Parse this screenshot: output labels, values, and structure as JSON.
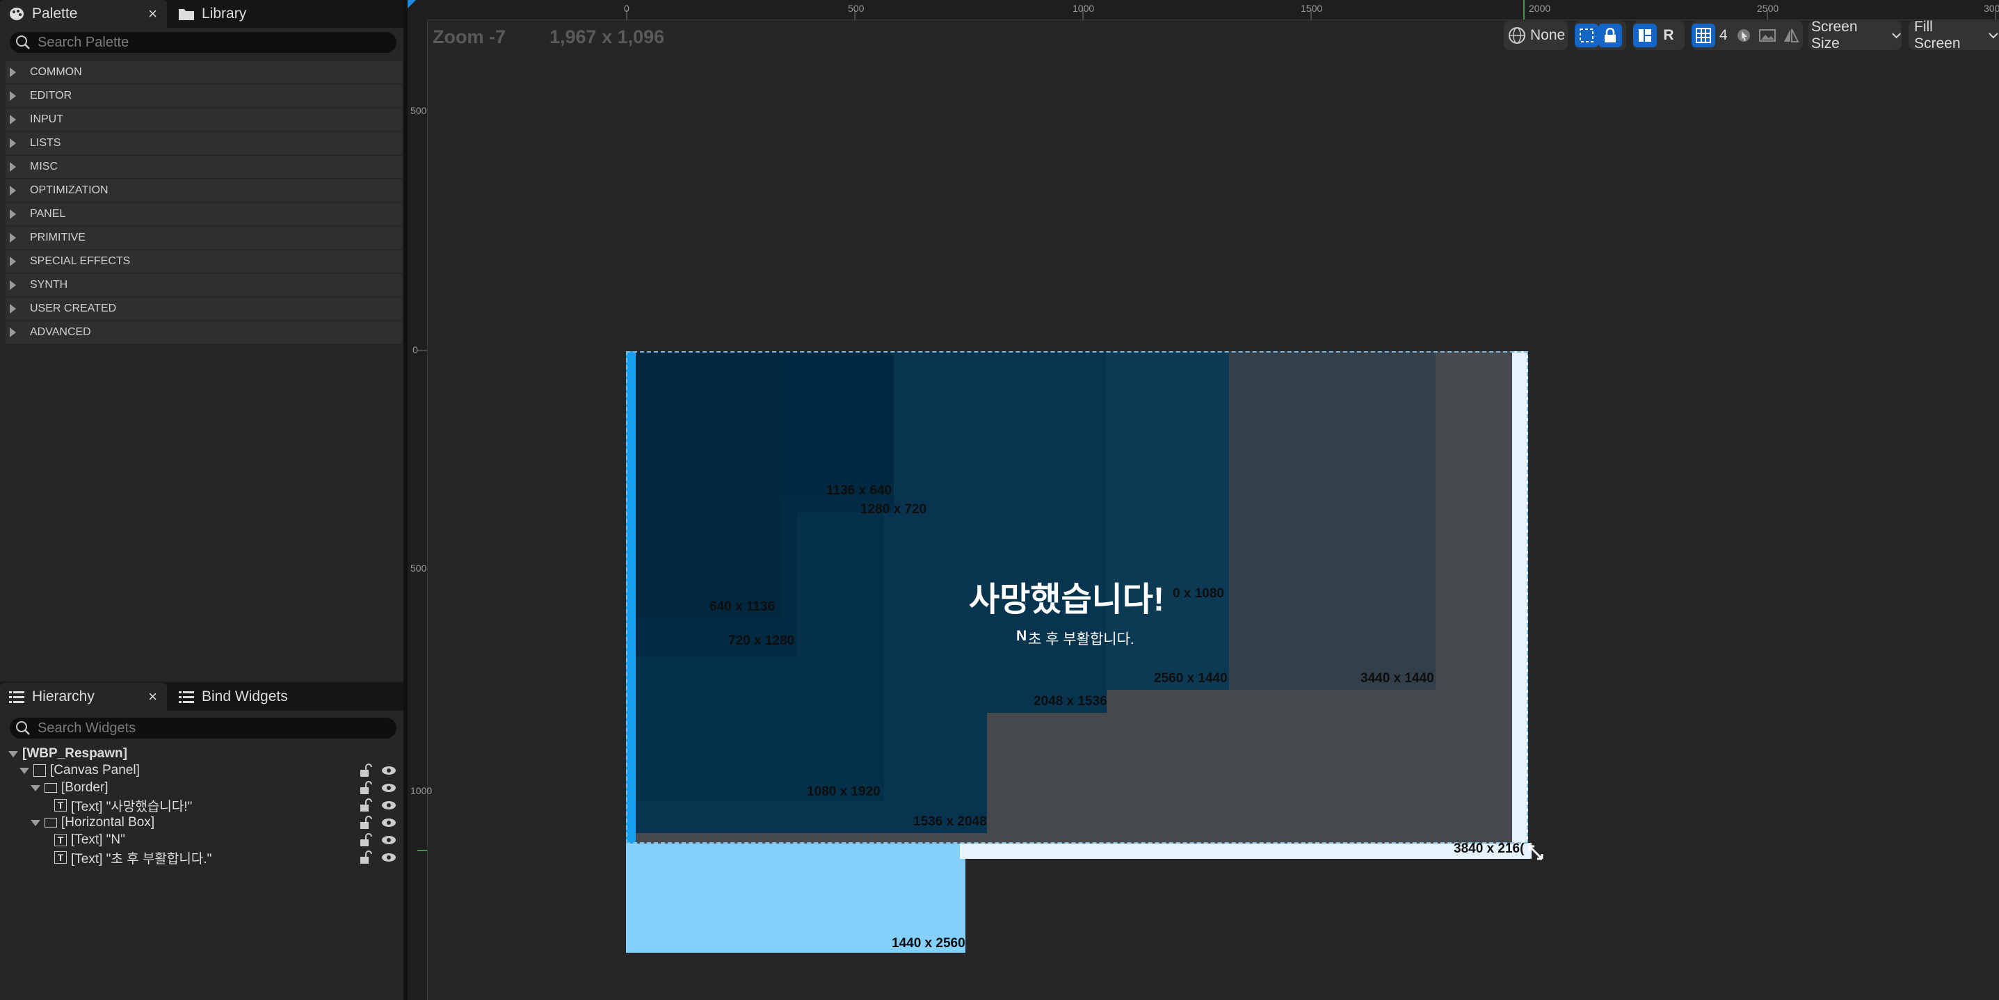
{
  "palette": {
    "tab_label": "Palette",
    "close": "×",
    "library_tab_label": "Library",
    "search_placeholder": "Search Palette",
    "categories": [
      "COMMON",
      "EDITOR",
      "INPUT",
      "LISTS",
      "MISC",
      "OPTIMIZATION",
      "PANEL",
      "PRIMITIVE",
      "SPECIAL EFFECTS",
      "SYNTH",
      "USER CREATED",
      "ADVANCED"
    ]
  },
  "hierarchy": {
    "tab_label": "Hierarchy",
    "close": "×",
    "bind_tab_label": "Bind Widgets",
    "search_placeholder": "Search Widgets",
    "root": "[WBP_Respawn]",
    "items": [
      {
        "label": "[Canvas Panel]"
      },
      {
        "label": "[Border]"
      },
      {
        "label": "[Text] \"사망했습니다!\""
      },
      {
        "label": "[Horizontal Box]"
      },
      {
        "label": "[Text] \"N\""
      },
      {
        "label": "[Text] \"초 후 부활합니다.\""
      }
    ]
  },
  "designer": {
    "zoom": "Zoom -7",
    "size": "1,967 x 1,096",
    "ruler_top": [
      "0",
      "500",
      "1000",
      "1500",
      "2000",
      "2500",
      "300"
    ],
    "ruler_left": [
      "500",
      "0",
      "500",
      "1000"
    ],
    "toolbar": {
      "none_label": "None",
      "r_label": "R",
      "grid_count": "4",
      "screen_size": "Screen Size",
      "fill_screen": "Fill Screen"
    },
    "widget_title": "사망했습니다!",
    "widget_n": "N",
    "widget_subtitle": "초 후 부활합니다.",
    "resolutions": [
      "1136 x 640",
      "1280 x 720",
      "640 x 1136",
      "720 x 1280",
      "0 x 1080",
      "2560 x 1440",
      "3440 x 1440",
      "2048 x 1536",
      "1080 x 1920",
      "1536 x 2048",
      "3840 x 216(",
      "1440 x 2560"
    ]
  },
  "colors": {
    "accent": "#1366c8",
    "preview_dark": "#012a42",
    "preview_mid": "#0c3a55",
    "preview_slate": "#333f4b",
    "preview_gray": "#464a4f",
    "preview_light": "#e6f5fd",
    "preview_sky": "#82d0fb"
  }
}
